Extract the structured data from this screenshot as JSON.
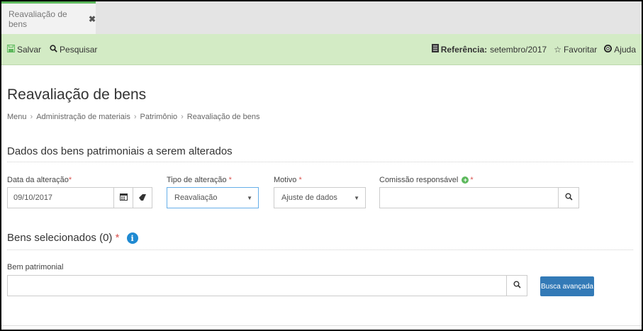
{
  "tab": {
    "label": "Reavaliação de bens",
    "close": "✖"
  },
  "toolbar": {
    "save_label": "Salvar",
    "search_label": "Pesquisar",
    "reference_label": "Referência:",
    "reference_value": "setembro/2017",
    "favorite_label": "Favoritar",
    "help_label": "Ajuda"
  },
  "page": {
    "title": "Reavaliação de bens",
    "breadcrumb": [
      "Menu",
      "Administração de materiais",
      "Patrimônio",
      "Reavaliação de bens"
    ]
  },
  "section1": {
    "title": "Dados dos bens patrimoniais a serem alterados",
    "date_label": "Data da alteração",
    "date_value": "09/10/2017",
    "type_label": "Tipo de alteração",
    "type_value": "Reavaliação",
    "reason_label": "Motivo",
    "reason_value": "Ajuste de dados",
    "committee_label": "Comissão responsável",
    "committee_value": "",
    "required_mark": "*"
  },
  "section2": {
    "title": "Bens selecionados (0)",
    "required_mark": "*",
    "asset_label": "Bem patrimonial",
    "asset_value": "",
    "advanced_search_label": "Busca avançada"
  },
  "colors": {
    "accent_green": "#5cb85c",
    "toolbar_bg": "#d3ebc5",
    "primary": "#337ab7",
    "required": "#d9534f"
  },
  "icons": [
    "save-icon",
    "search-icon",
    "book-icon",
    "star-icon",
    "lifebuoy-icon",
    "close-icon",
    "calendar-icon",
    "eraser-icon",
    "caret-down-icon",
    "plus-circle-icon",
    "info-icon"
  ]
}
